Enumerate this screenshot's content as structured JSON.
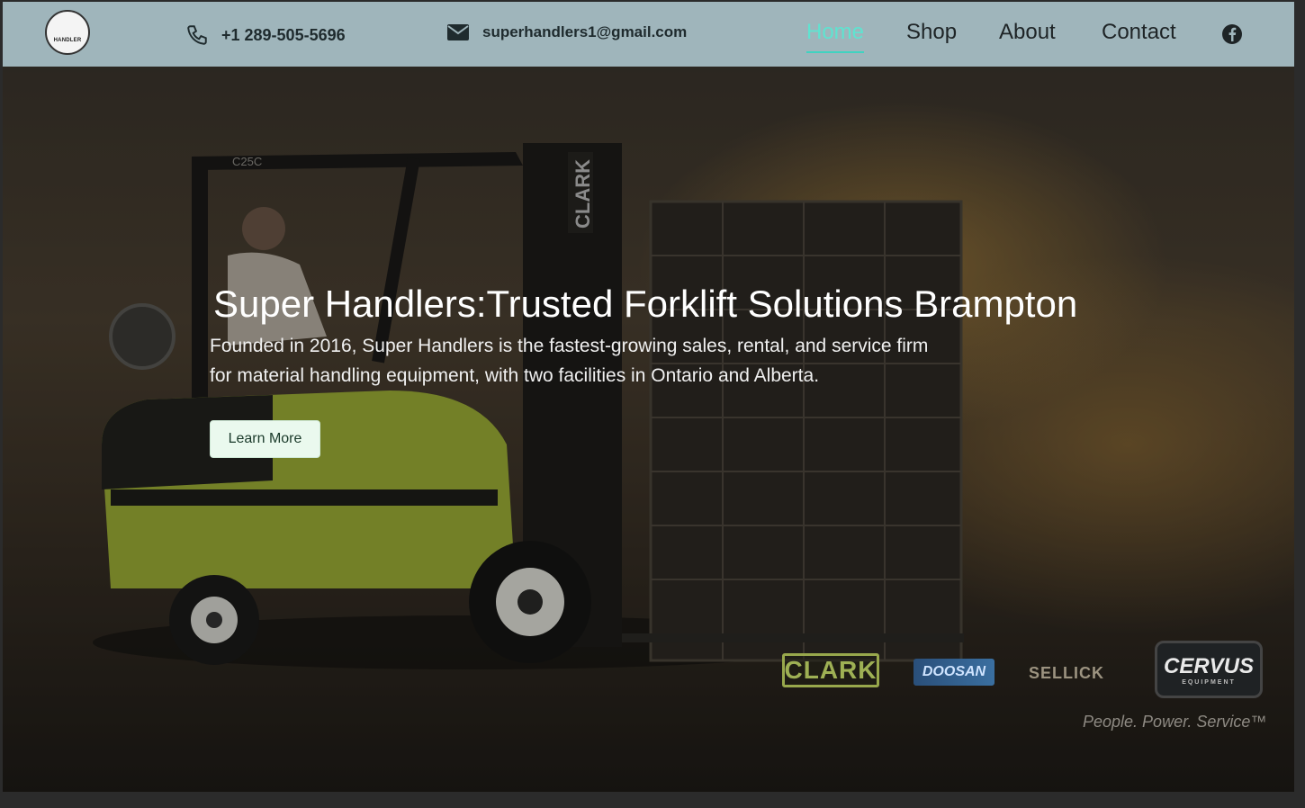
{
  "header": {
    "logo_text": "HANDLER",
    "phone": "+1 289-505-5696",
    "email": "superhandlers1@gmail.com",
    "nav": [
      "Home",
      "Shop",
      "About",
      "Contact"
    ],
    "active_nav": "Home"
  },
  "hero": {
    "title": "Super Handlers:Trusted Forklift Solutions Brampton",
    "description": "Founded in 2016, Super Handlers is the fastest-growing sales, rental, and service firm for material handling equipment, with two facilities in Ontario and Alberta.",
    "button_label": "Learn More"
  },
  "brands": {
    "clark": "CLARK",
    "doosan": "DOOSAN",
    "sellick": "SELLICK",
    "cervus": "CERVUS",
    "cervus_sub": "EQUIPMENT",
    "tagline": "People. Power. Service™"
  },
  "forklift": {
    "mast_label": "CLARK",
    "model_label": "C25C"
  },
  "colors": {
    "nav_bg": "#9fb5bb",
    "active_link": "#5fe3d0",
    "button_bg": "#eaf9ee"
  }
}
